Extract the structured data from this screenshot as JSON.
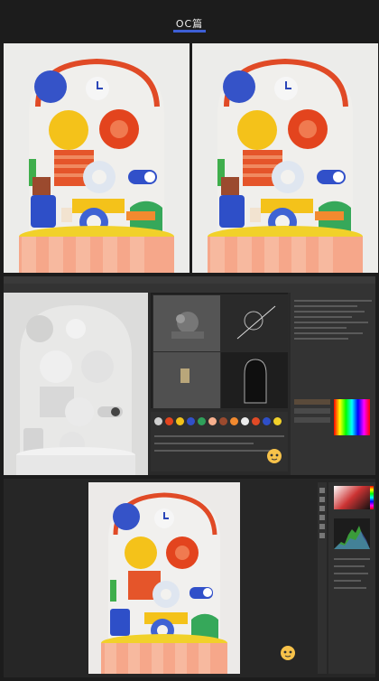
{
  "page": {
    "title": "OC篇"
  },
  "sections": {
    "renders_top": "render-pair",
    "c4d_editor": "c4d-workspace",
    "ps_editor": "photoshop-workspace"
  },
  "colors": {
    "background": "#1c1c1c",
    "title_underline": "#3d5fd6",
    "orange_red": "#e3441e",
    "yellow": "#f2c11a",
    "blue": "#3150c9",
    "green": "#2fa05a",
    "white": "#f3f2ef",
    "peach": "#f7b08e"
  }
}
